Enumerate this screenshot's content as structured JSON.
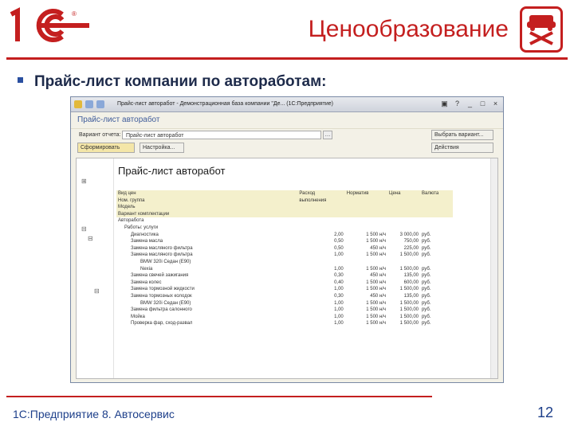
{
  "slide": {
    "title": "Ценообразование",
    "bullet": "Прайс-лист компании по автоработам:",
    "footer": "1С:Предприятие 8. Автосервис",
    "page_number": "12",
    "accent_color": "#c41f1f",
    "text_color": "#1d3f8a"
  },
  "window": {
    "title": "Прайс-лист авторабот - Демонстрационная база компании \"Де... (1С:Предприятие)",
    "heading": "Прайс-лист авторабот",
    "field1_label": "Вариант отчета:",
    "field1_value": "Прайс-лист авторабот",
    "right_button1": "Выбрать вариант...",
    "generate_button": "Сформировать",
    "settings_button": "Настройка...",
    "right_button2": "Действия",
    "report_title": "Прайс-лист авторабот"
  },
  "table": {
    "headers": [
      [
        "Вид цен",
        "Расход",
        "Норматив",
        "Цена",
        "Валюта"
      ],
      [
        "Ном. группа",
        "выполнения",
        "",
        "",
        ""
      ],
      [
        "Модель",
        "",
        "",
        "",
        ""
      ],
      [
        "Вариант комплектации",
        "",
        "",
        "",
        ""
      ],
      [
        "Авторабота",
        "",
        "",
        "",
        ""
      ]
    ],
    "rows": [
      {
        "level": 1,
        "name": "Работы: услуги",
        "qty": "",
        "norm": "",
        "price": "",
        "cur": ""
      },
      {
        "level": 2,
        "name": "Диагностика",
        "qty": "2,00",
        "norm": "1 500 н/ч",
        "price": "3 000,00",
        "cur": "руб."
      },
      {
        "level": 2,
        "name": "Замена масла",
        "qty": "0,50",
        "norm": "1 500 н/ч",
        "price": "750,00",
        "cur": "руб."
      },
      {
        "level": 2,
        "name": "Замена масляного фильтра",
        "qty": "0,50",
        "norm": "450 н/ч",
        "price": "225,00",
        "cur": "руб."
      },
      {
        "level": 2,
        "name": "Замена масляного фильтра",
        "qty": "1,00",
        "norm": "1 500 н/ч",
        "price": "1 500,00",
        "cur": "руб."
      },
      {
        "level": 3,
        "name": "BMW 320i Седан (E90)",
        "qty": "",
        "norm": "",
        "price": "",
        "cur": ""
      },
      {
        "level": 3,
        "name": "Nexia",
        "qty": "1,00",
        "norm": "1 500 н/ч",
        "price": "1 500,00",
        "cur": "руб."
      },
      {
        "level": 2,
        "name": "Замена свечей зажигания",
        "qty": "0,30",
        "norm": "450 н/ч",
        "price": "135,00",
        "cur": "руб."
      },
      {
        "level": 2,
        "name": "Замена колес",
        "qty": "0,40",
        "norm": "1 500 н/ч",
        "price": "600,00",
        "cur": "руб."
      },
      {
        "level": 2,
        "name": "Замена тормозной жидкости",
        "qty": "1,00",
        "norm": "1 500 н/ч",
        "price": "1 500,00",
        "cur": "руб."
      },
      {
        "level": 2,
        "name": "Замена тормозных колодок",
        "qty": "0,30",
        "norm": "450 н/ч",
        "price": "135,00",
        "cur": "руб."
      },
      {
        "level": 3,
        "name": "BMW 320i Седан (E90)",
        "qty": "1,00",
        "norm": "1 500 н/ч",
        "price": "1 500,00",
        "cur": "руб."
      },
      {
        "level": 2,
        "name": "Замена фильтра салонного",
        "qty": "1,00",
        "norm": "1 500 н/ч",
        "price": "1 500,00",
        "cur": "руб."
      },
      {
        "level": 2,
        "name": "Мойка",
        "qty": "1,00",
        "norm": "1 500 н/ч",
        "price": "1 500,00",
        "cur": "руб."
      },
      {
        "level": 2,
        "name": "Проверка фар, сход-развал",
        "qty": "1,00",
        "norm": "1 500 н/ч",
        "price": "1 500,00",
        "cur": "руб."
      }
    ]
  }
}
